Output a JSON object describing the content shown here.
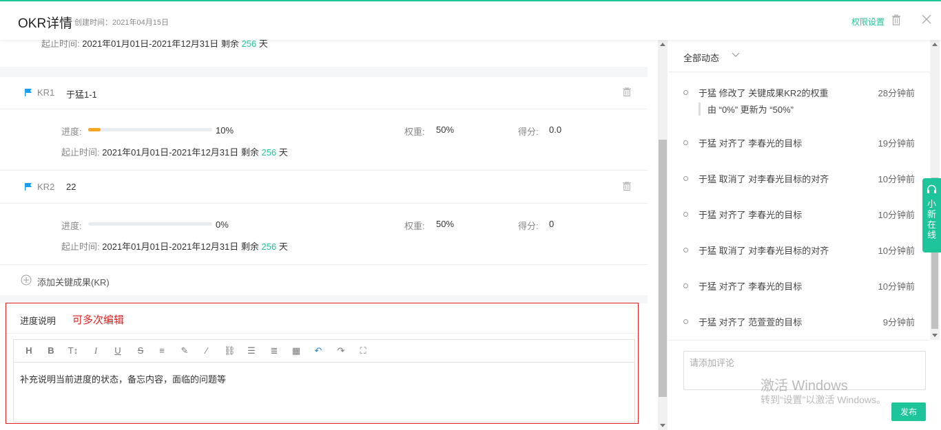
{
  "header": {
    "title": "OKR详情",
    "created": "创建时间：2021年04月15日",
    "permission_label": "权限设置"
  },
  "objective": {
    "period_label": "起止时间:",
    "period_value": "2021年01月01日-2021年12月31日 剩余",
    "remaining_days": "256",
    "days_unit": "天"
  },
  "krs": [
    {
      "tag": "KR1",
      "name": "于猛1-1",
      "progress_label": "进度:",
      "progress": 0.1,
      "progress_text": "10%",
      "weight_label": "权重:",
      "weight": "50%",
      "score_label": "得分:",
      "score": "0.0",
      "period_label": "起止时间:",
      "period_value": "2021年01月01日-2021年12月31日 剩余",
      "remaining_days": "256",
      "days_unit": "天"
    },
    {
      "tag": "KR2",
      "name": "22",
      "progress_label": "进度:",
      "progress": 0,
      "progress_text": "0%",
      "weight_label": "权重:",
      "weight": "50%",
      "score_label": "得分:",
      "score": "0",
      "period_label": "起止时间:",
      "period_value": "2021年01月01日-2021年12月31日 剩余",
      "remaining_days": "256",
      "days_unit": "天"
    }
  ],
  "add_kr_label": "添加关键成果(KR)",
  "progress_note": {
    "title": "进度说明",
    "annotation": "可多次编辑",
    "placeholder": "补充说明当前进度的状态，备忘内容，面临的问题等"
  },
  "toolbar_icons": [
    "H",
    "B",
    "TI",
    "I",
    "U",
    "S",
    "align",
    "pen",
    "brush",
    "link",
    "list",
    "indent",
    "table",
    "undo",
    "redo",
    "fullscreen"
  ],
  "activity": {
    "filter_label": "全部动态",
    "items": [
      {
        "text": "于猛 修改了 关键成果KR2的权重",
        "time": "28分钟前",
        "detail": "由 “0%” 更新为 “50%”"
      },
      {
        "text": "于猛 对齐了 李春光的目标",
        "time": "19分钟前"
      },
      {
        "text": "于猛 取消了 对李春光目标的对齐",
        "time": "10分钟前"
      },
      {
        "text": "于猛 对齐了 李春光的目标",
        "time": "10分钟前"
      },
      {
        "text": "于猛 取消了 对李春光目标的对齐",
        "time": "10分钟前"
      },
      {
        "text": "于猛 对齐了 李春光的目标",
        "time": "10分钟前"
      },
      {
        "text": "于猛 对齐了 范萱萱的目标",
        "time": "9分钟前"
      }
    ],
    "comment_placeholder": "请添加评论",
    "publish_label": "发布"
  },
  "watermark": {
    "line1": "激活 Windows",
    "line2": "转到“设置”以激活 Windows。"
  },
  "side_tab": {
    "label": "小新在线"
  },
  "colors": {
    "accent": "#1fc59a",
    "progress": "#f5a623",
    "flag": "#1a9ef0",
    "annotation": "#e02020"
  }
}
